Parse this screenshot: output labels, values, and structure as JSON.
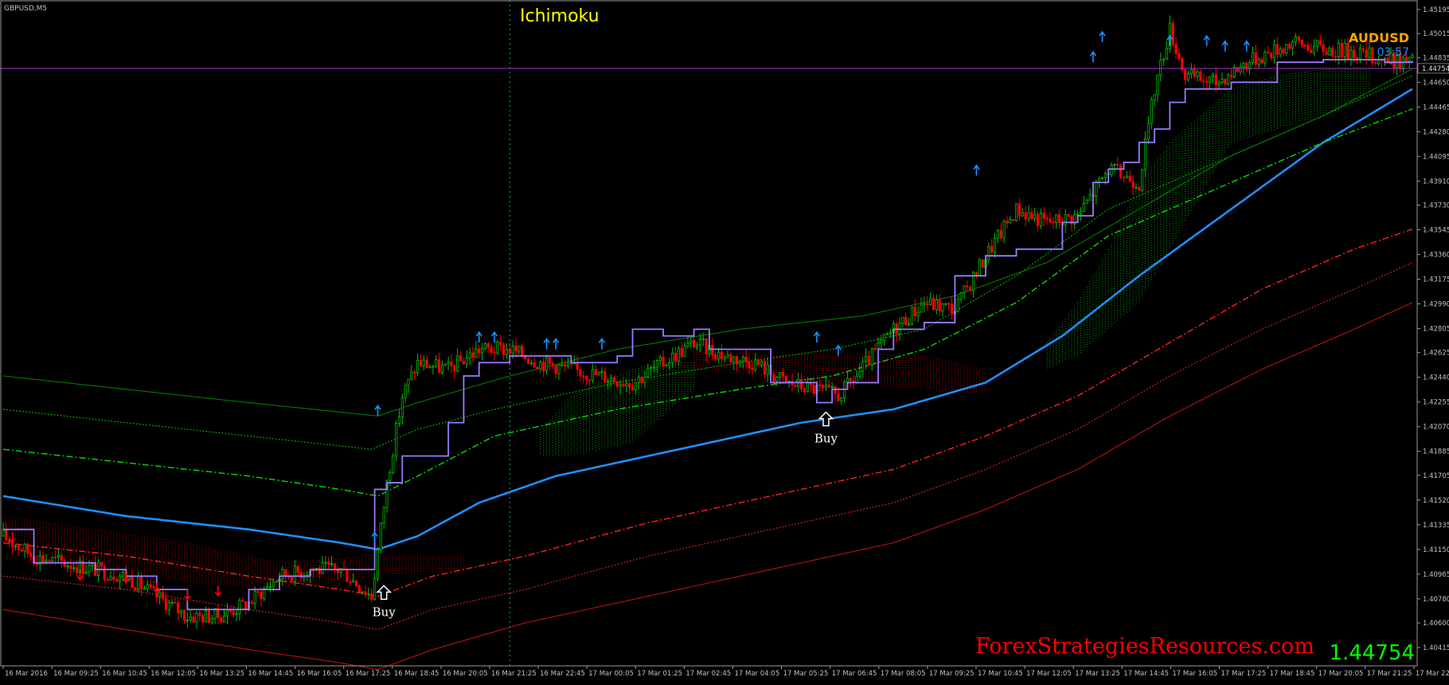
{
  "symbol_label": "GBPUSD,M5",
  "indicator_title": "Ichimoku",
  "corner": {
    "pair": "AUDUSD",
    "timer": "03:57"
  },
  "watermark": "ForexStrategiesResources.com",
  "current_price": "1.44754",
  "price_tag": "1.44754",
  "buy_label": "Buy",
  "colors": {
    "background": "#000000",
    "candle_up": "#00c000",
    "candle_down": "#ff0000",
    "kijun": "#9a7cff",
    "blue_ma": "#1e90ff",
    "signal_arrow": "#1e90ff",
    "title": "#ffff00",
    "pair_label": "#ffa500",
    "timer": "#1e90ff",
    "watermark": "#ff0000",
    "current_price": "#00ff00",
    "hline": "#9932cc"
  },
  "chart_data": {
    "type": "candlestick",
    "price_ticks": [
      "1.45195",
      "1.45015",
      "1.44835",
      "1.44650",
      "1.44465",
      "1.44280",
      "1.44095",
      "1.43910",
      "1.43730",
      "1.43545",
      "1.43360",
      "1.43175",
      "1.42990",
      "1.42805",
      "1.42625",
      "1.42440",
      "1.42255",
      "1.42070",
      "1.41885",
      "1.41705",
      "1.41520",
      "1.41335",
      "1.41150",
      "1.40965",
      "1.40780",
      "1.40600",
      "1.40415"
    ],
    "time_ticks": [
      "16 Mar 2016",
      "16 Mar 09:25",
      "16 Mar 10:45",
      "16 Mar 12:05",
      "16 Mar 13:25",
      "16 Mar 14:45",
      "16 Mar 16:05",
      "16 Mar 17:25",
      "16 Mar 18:45",
      "16 Mar 20:05",
      "16 Mar 21:25",
      "16 Mar 22:45",
      "17 Mar 00:05",
      "17 Mar 01:25",
      "17 Mar 02:45",
      "17 Mar 04:05",
      "17 Mar 05:25",
      "17 Mar 06:45",
      "17 Mar 08:05",
      "17 Mar 09:25",
      "17 Mar 10:45",
      "17 Mar 12:05",
      "17 Mar 13:25",
      "17 Mar 14:45",
      "17 Mar 16:05",
      "17 Mar 17:25",
      "17 Mar 18:45",
      "17 Mar 20:05",
      "17 Mar 21:25",
      "17 Mar 22:"
    ],
    "horizontal_line_price": 1.44754,
    "close_path": [
      [
        0,
        1.4125
      ],
      [
        10,
        1.411
      ],
      [
        20,
        1.4105
      ],
      [
        30,
        1.41
      ],
      [
        40,
        1.4095
      ],
      [
        50,
        1.408
      ],
      [
        60,
        1.4065
      ],
      [
        70,
        1.4065
      ],
      [
        80,
        1.4075
      ],
      [
        90,
        1.4095
      ],
      [
        100,
        1.41
      ],
      [
        110,
        1.41
      ],
      [
        120,
        1.408
      ],
      [
        125,
        1.4165
      ],
      [
        130,
        1.423
      ],
      [
        135,
        1.4255
      ],
      [
        145,
        1.425
      ],
      [
        155,
        1.4265
      ],
      [
        165,
        1.4265
      ],
      [
        175,
        1.4255
      ],
      [
        185,
        1.425
      ],
      [
        195,
        1.4245
      ],
      [
        205,
        1.424
      ],
      [
        215,
        1.4255
      ],
      [
        225,
        1.427
      ],
      [
        235,
        1.426
      ],
      [
        245,
        1.4255
      ],
      [
        255,
        1.424
      ],
      [
        265,
        1.4235
      ],
      [
        272,
        1.423
      ],
      [
        278,
        1.4245
      ],
      [
        283,
        1.426
      ],
      [
        290,
        1.428
      ],
      [
        300,
        1.43
      ],
      [
        310,
        1.4295
      ],
      [
        320,
        1.4335
      ],
      [
        330,
        1.437
      ],
      [
        340,
        1.436
      ],
      [
        350,
        1.4365
      ],
      [
        360,
        1.44
      ],
      [
        370,
        1.439
      ],
      [
        375,
        1.446
      ],
      [
        380,
        1.4505
      ],
      [
        385,
        1.447
      ],
      [
        395,
        1.4465
      ],
      [
        405,
        1.448
      ],
      [
        415,
        1.449
      ],
      [
        420,
        1.4495
      ],
      [
        430,
        1.449
      ],
      [
        440,
        1.4488
      ],
      [
        450,
        1.4482
      ],
      [
        459,
        1.448
      ]
    ],
    "kijun_path": [
      [
        0,
        1.413
      ],
      [
        10,
        1.4105
      ],
      [
        20,
        1.4105
      ],
      [
        30,
        1.41
      ],
      [
        40,
        1.4095
      ],
      [
        50,
        1.4085
      ],
      [
        60,
        1.407
      ],
      [
        70,
        1.407
      ],
      [
        80,
        1.4085
      ],
      [
        90,
        1.4095
      ],
      [
        100,
        1.41
      ],
      [
        120,
        1.41
      ],
      [
        121,
        1.416
      ],
      [
        125,
        1.4165
      ],
      [
        130,
        1.4185
      ],
      [
        140,
        1.4185
      ],
      [
        145,
        1.421
      ],
      [
        150,
        1.4245
      ],
      [
        155,
        1.4255
      ],
      [
        165,
        1.426
      ],
      [
        175,
        1.426
      ],
      [
        185,
        1.4255
      ],
      [
        195,
        1.4255
      ],
      [
        200,
        1.426
      ],
      [
        205,
        1.428
      ],
      [
        215,
        1.4275
      ],
      [
        220,
        1.4275
      ],
      [
        225,
        1.428
      ],
      [
        230,
        1.4265
      ],
      [
        240,
        1.4265
      ],
      [
        250,
        1.424
      ],
      [
        260,
        1.424
      ],
      [
        265,
        1.4225
      ],
      [
        270,
        1.4235
      ],
      [
        275,
        1.424
      ],
      [
        280,
        1.424
      ],
      [
        285,
        1.4265
      ],
      [
        290,
        1.428
      ],
      [
        300,
        1.4285
      ],
      [
        305,
        1.4285
      ],
      [
        310,
        1.432
      ],
      [
        320,
        1.4335
      ],
      [
        330,
        1.434
      ],
      [
        340,
        1.434
      ],
      [
        345,
        1.436
      ],
      [
        350,
        1.4365
      ],
      [
        355,
        1.439
      ],
      [
        360,
        1.44
      ],
      [
        365,
        1.4405
      ],
      [
        370,
        1.442
      ],
      [
        375,
        1.443
      ],
      [
        380,
        1.445
      ],
      [
        385,
        1.446
      ],
      [
        400,
        1.4465
      ],
      [
        415,
        1.448
      ],
      [
        425,
        1.448
      ],
      [
        430,
        1.4482
      ],
      [
        450,
        1.448
      ],
      [
        459,
        1.4481
      ]
    ],
    "lines": [
      {
        "style": "solid",
        "color": "#1e90ff",
        "width": 2.6,
        "points": [
          [
            0,
            1.4155
          ],
          [
            40,
            1.414
          ],
          [
            80,
            1.413
          ],
          [
            110,
            1.412
          ],
          [
            122,
            1.4115
          ],
          [
            135,
            1.4125
          ],
          [
            155,
            1.415
          ],
          [
            180,
            1.417
          ],
          [
            220,
            1.419
          ],
          [
            260,
            1.421
          ],
          [
            290,
            1.422
          ],
          [
            320,
            1.424
          ],
          [
            345,
            1.4275
          ],
          [
            370,
            1.432
          ],
          [
            400,
            1.437
          ],
          [
            430,
            1.442
          ],
          [
            459,
            1.446
          ]
        ]
      },
      {
        "style": "dashdot",
        "color": "#00dd00",
        "width": 1.4,
        "points": [
          [
            0,
            1.419
          ],
          [
            40,
            1.418
          ],
          [
            80,
            1.417
          ],
          [
            110,
            1.416
          ],
          [
            122,
            1.4155
          ],
          [
            135,
            1.417
          ],
          [
            160,
            1.42
          ],
          [
            200,
            1.422
          ],
          [
            240,
            1.4235
          ],
          [
            270,
            1.4245
          ],
          [
            300,
            1.4265
          ],
          [
            330,
            1.43
          ],
          [
            360,
            1.435
          ],
          [
            400,
            1.439
          ],
          [
            430,
            1.442
          ],
          [
            459,
            1.4445
          ]
        ]
      },
      {
        "style": "dotted",
        "color": "#00aa00",
        "width": 1.2,
        "points": [
          [
            0,
            1.422
          ],
          [
            40,
            1.421
          ],
          [
            80,
            1.42
          ],
          [
            120,
            1.419
          ],
          [
            135,
            1.4205
          ],
          [
            160,
            1.422
          ],
          [
            200,
            1.424
          ],
          [
            240,
            1.4255
          ],
          [
            270,
            1.4265
          ],
          [
            300,
            1.428
          ],
          [
            330,
            1.432
          ],
          [
            360,
            1.437
          ],
          [
            400,
            1.441
          ],
          [
            430,
            1.444
          ],
          [
            459,
            1.447
          ]
        ]
      },
      {
        "style": "solid",
        "color": "#008800",
        "width": 1.0,
        "points": [
          [
            0,
            1.4245
          ],
          [
            40,
            1.4235
          ],
          [
            80,
            1.4225
          ],
          [
            122,
            1.4215
          ],
          [
            135,
            1.4225
          ],
          [
            165,
            1.4245
          ],
          [
            200,
            1.4265
          ],
          [
            240,
            1.428
          ],
          [
            280,
            1.429
          ],
          [
            310,
            1.4305
          ],
          [
            340,
            1.433
          ],
          [
            370,
            1.437
          ],
          [
            400,
            1.441
          ],
          [
            430,
            1.444
          ],
          [
            459,
            1.4475
          ]
        ]
      },
      {
        "style": "dashdot",
        "color": "#ff2020",
        "width": 1.4,
        "points": [
          [
            0,
            1.412
          ],
          [
            40,
            1.411
          ],
          [
            80,
            1.4095
          ],
          [
            110,
            1.4085
          ],
          [
            122,
            1.408
          ],
          [
            140,
            1.4095
          ],
          [
            170,
            1.411
          ],
          [
            210,
            1.4135
          ],
          [
            250,
            1.4155
          ],
          [
            290,
            1.4175
          ],
          [
            320,
            1.42
          ],
          [
            350,
            1.423
          ],
          [
            380,
            1.427
          ],
          [
            410,
            1.431
          ],
          [
            440,
            1.434
          ],
          [
            459,
            1.4355
          ]
        ]
      },
      {
        "style": "dotted",
        "color": "#cc2020",
        "width": 1.2,
        "points": [
          [
            0,
            1.4095
          ],
          [
            40,
            1.4085
          ],
          [
            80,
            1.407
          ],
          [
            110,
            1.406
          ],
          [
            122,
            1.4055
          ],
          [
            140,
            1.407
          ],
          [
            170,
            1.4085
          ],
          [
            210,
            1.411
          ],
          [
            250,
            1.413
          ],
          [
            290,
            1.415
          ],
          [
            320,
            1.4175
          ],
          [
            350,
            1.4205
          ],
          [
            380,
            1.4245
          ],
          [
            410,
            1.428
          ],
          [
            440,
            1.431
          ],
          [
            459,
            1.433
          ]
        ]
      },
      {
        "style": "solid",
        "color": "#aa1010",
        "width": 1.2,
        "points": [
          [
            0,
            1.407
          ],
          [
            40,
            1.4055
          ],
          [
            80,
            1.404
          ],
          [
            110,
            1.403
          ],
          [
            122,
            1.4025
          ],
          [
            140,
            1.404
          ],
          [
            170,
            1.406
          ],
          [
            210,
            1.408
          ],
          [
            250,
            1.41
          ],
          [
            290,
            1.412
          ],
          [
            320,
            1.4145
          ],
          [
            350,
            1.4175
          ],
          [
            380,
            1.4215
          ],
          [
            410,
            1.425
          ],
          [
            440,
            1.428
          ],
          [
            459,
            1.43
          ]
        ]
      }
    ],
    "kumo": [
      {
        "fill": "green",
        "top": [
          [
            175,
            1.4205
          ],
          [
            185,
            1.423
          ],
          [
            195,
            1.424
          ],
          [
            205,
            1.425
          ],
          [
            215,
            1.4255
          ],
          [
            225,
            1.4255
          ]
        ],
        "bottom": [
          [
            175,
            1.4185
          ],
          [
            185,
            1.4185
          ],
          [
            195,
            1.419
          ],
          [
            205,
            1.4195
          ],
          [
            215,
            1.4215
          ],
          [
            225,
            1.4235
          ]
        ]
      },
      {
        "fill": "green",
        "top": [
          [
            340,
            1.427
          ],
          [
            350,
            1.43
          ],
          [
            360,
            1.434
          ],
          [
            370,
            1.439
          ],
          [
            380,
            1.442
          ],
          [
            390,
            1.444
          ],
          [
            400,
            1.446
          ],
          [
            415,
            1.447
          ],
          [
            430,
            1.4475
          ],
          [
            445,
            1.4475
          ]
        ],
        "bottom": [
          [
            340,
            1.425
          ],
          [
            350,
            1.426
          ],
          [
            360,
            1.428
          ],
          [
            370,
            1.43
          ],
          [
            380,
            1.434
          ],
          [
            390,
            1.438
          ],
          [
            400,
            1.442
          ],
          [
            415,
            1.443
          ],
          [
            430,
            1.444
          ],
          [
            445,
            1.4455
          ]
        ]
      },
      {
        "fill": "red",
        "top": [
          [
            0,
            1.414
          ],
          [
            30,
            1.413
          ],
          [
            60,
            1.412
          ],
          [
            90,
            1.4105
          ],
          [
            120,
            1.411
          ],
          [
            150,
            1.411
          ]
        ],
        "bottom": [
          [
            0,
            1.412
          ],
          [
            30,
            1.41
          ],
          [
            60,
            1.409
          ],
          [
            90,
            1.4085
          ],
          [
            120,
            1.4095
          ],
          [
            150,
            1.41
          ]
        ]
      },
      {
        "fill": "red",
        "top": [
          [
            225,
            1.4265
          ],
          [
            250,
            1.426
          ],
          [
            270,
            1.4262
          ],
          [
            300,
            1.426
          ],
          [
            320,
            1.425
          ]
        ],
        "bottom": [
          [
            225,
            1.425
          ],
          [
            250,
            1.4245
          ],
          [
            270,
            1.424
          ],
          [
            300,
            1.4235
          ],
          [
            320,
            1.423
          ]
        ]
      }
    ],
    "signal_arrows": [
      {
        "dir": "down",
        "i": 3,
        "price": 1.4128
      },
      {
        "dir": "down",
        "i": 25,
        "price": 1.41
      },
      {
        "dir": "down",
        "i": 40,
        "price": 1.4098
      },
      {
        "dir": "down",
        "i": 50,
        "price": 1.409
      },
      {
        "dir": "down",
        "i": 60,
        "price": 1.4085
      },
      {
        "dir": "down",
        "i": 70,
        "price": 1.4088
      },
      {
        "dir": "up",
        "i": 121,
        "price": 1.412
      },
      {
        "dir": "up",
        "i": 122,
        "price": 1.4215
      },
      {
        "dir": "up",
        "i": 155,
        "price": 1.427
      },
      {
        "dir": "up",
        "i": 160,
        "price": 1.427
      },
      {
        "dir": "up",
        "i": 177,
        "price": 1.4265
      },
      {
        "dir": "up",
        "i": 180,
        "price": 1.4265
      },
      {
        "dir": "up",
        "i": 195,
        "price": 1.4265
      },
      {
        "dir": "up",
        "i": 265,
        "price": 1.427
      },
      {
        "dir": "up",
        "i": 272,
        "price": 1.426
      },
      {
        "dir": "up",
        "i": 317,
        "price": 1.4395
      },
      {
        "dir": "up",
        "i": 355,
        "price": 1.448
      },
      {
        "dir": "up",
        "i": 358,
        "price": 1.4495
      },
      {
        "dir": "up",
        "i": 380,
        "price": 1.4492
      },
      {
        "dir": "up",
        "i": 392,
        "price": 1.4492
      },
      {
        "dir": "up",
        "i": 398,
        "price": 1.4488
      },
      {
        "dir": "up",
        "i": 405,
        "price": 1.4488
      }
    ],
    "buy_signals": [
      {
        "i": 124,
        "price": 1.4095
      },
      {
        "i": 268,
        "price": 1.4225
      }
    ],
    "vertical_line_index": 165
  }
}
